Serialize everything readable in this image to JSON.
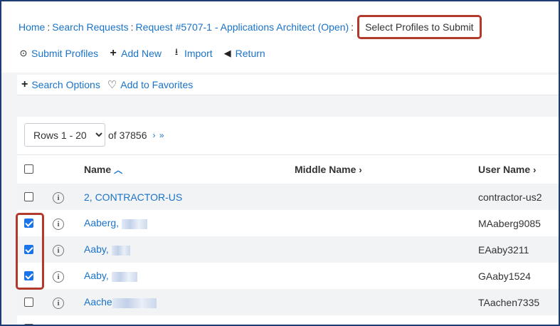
{
  "breadcrumb": {
    "home": "Home",
    "search_requests": "Search Requests",
    "request": "Request #5707-1 - Applications Architect (Open)",
    "current": "Select Profiles to Submit"
  },
  "actions": {
    "submit": "Submit Profiles",
    "add_new": "Add New",
    "import": "Import",
    "return": "Return"
  },
  "options": {
    "search_options": "Search Options",
    "add_favorites": "Add to Favorites"
  },
  "pager": {
    "rows_selected": "Rows 1 - 20",
    "total": "of 37856",
    "nav": "› »"
  },
  "columns": {
    "name": "Name",
    "middle_name": "Middle Name",
    "user_name": "User Name"
  },
  "rows": [
    {
      "name": "2, CONTRACTOR-US",
      "middle": "",
      "user": "contractor-us2",
      "checked": false
    },
    {
      "name": "Aaberg,",
      "middle": "",
      "user": "MAaberg9085",
      "checked": true
    },
    {
      "name": "Aaby,",
      "middle": "",
      "user": "EAaby3211",
      "checked": true
    },
    {
      "name": "Aaby,",
      "middle": "",
      "user": "GAaby1524",
      "checked": true
    },
    {
      "name": "Aache",
      "middle": "",
      "user": "TAachen7335",
      "checked": false
    }
  ],
  "colors": {
    "link": "#1a73c8",
    "highlight": "#b23a2c",
    "checkbox": "#1a73e8"
  }
}
